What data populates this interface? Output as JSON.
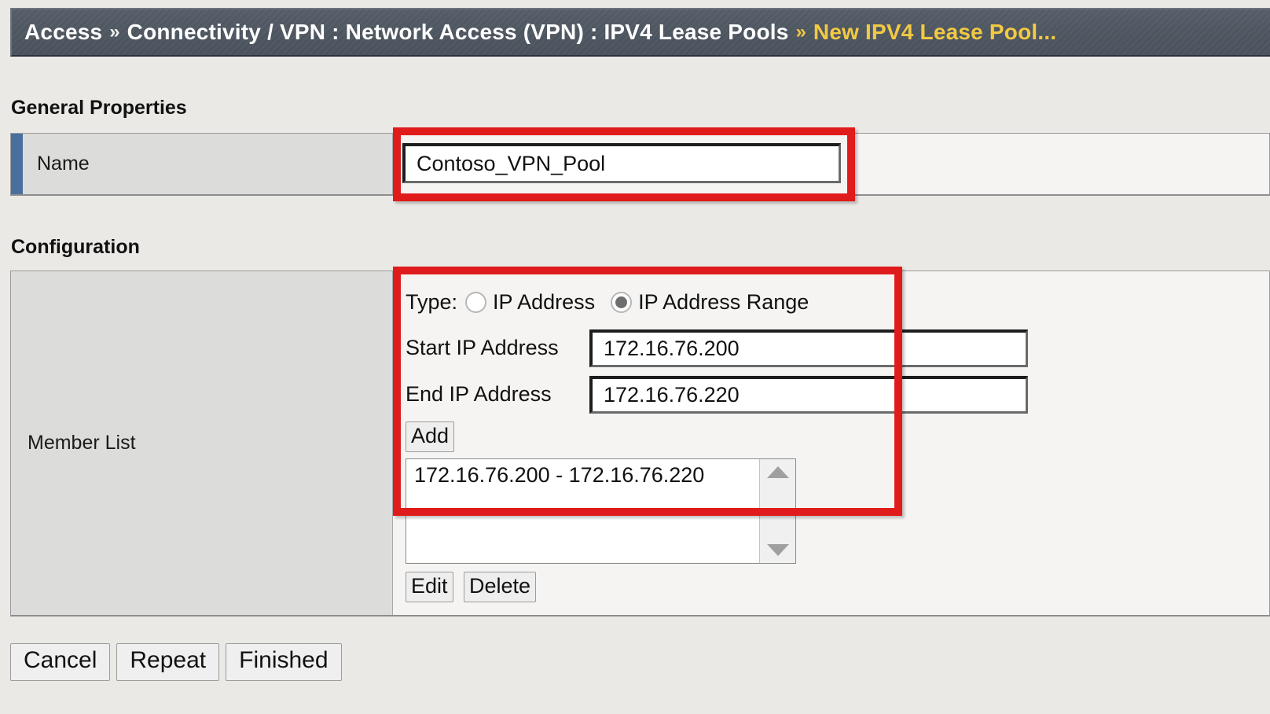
{
  "breadcrumb": {
    "root": "Access",
    "sep1": "»",
    "path": "Connectivity / VPN : Network Access (VPN) : IPV4 Lease Pools",
    "sep2": "»",
    "current": "New IPV4 Lease Pool..."
  },
  "sections": {
    "general_properties_title": "General Properties",
    "configuration_title": "Configuration"
  },
  "general": {
    "name_label": "Name",
    "name_value": "Contoso_VPN_Pool",
    "name_placeholder": ""
  },
  "configuration": {
    "member_list_label": "Member List",
    "type_label": "Type:",
    "type_options": [
      {
        "label": "IP Address",
        "selected": false
      },
      {
        "label": "IP Address Range",
        "selected": true
      }
    ],
    "start_ip_label": "Start IP Address",
    "start_ip_value": "172.16.76.200",
    "end_ip_label": "End IP Address",
    "end_ip_value": "172.16.76.220",
    "add_label": "Add",
    "member_items": [
      "172.16.76.200 - 172.16.76.220"
    ],
    "edit_label": "Edit",
    "delete_label": "Delete",
    "scroll_up_icon": "triangle-up-icon",
    "scroll_down_icon": "triangle-down-icon"
  },
  "footer": {
    "cancel_label": "Cancel",
    "repeat_label": "Repeat",
    "finished_label": "Finished"
  },
  "colors": {
    "header_bg": "#4e5660",
    "header_current_text": "#f2c943",
    "accent_bar": "#4a6f9e",
    "annotation_red": "#e01b1b",
    "page_bg": "#eae9e5"
  }
}
